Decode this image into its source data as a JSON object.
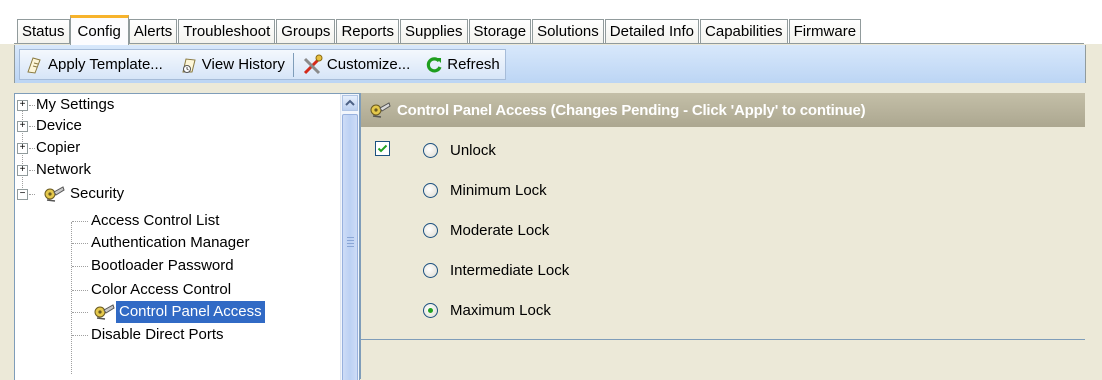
{
  "tabs": [
    "Status",
    "Config",
    "Alerts",
    "Troubleshoot",
    "Groups",
    "Reports",
    "Supplies",
    "Storage",
    "Solutions",
    "Detailed Info",
    "Capabilities",
    "Firmware"
  ],
  "active_tab": "Config",
  "toolbar": {
    "apply_template": "Apply Template...",
    "view_history": "View History",
    "customize": "Customize...",
    "refresh": "Refresh"
  },
  "tree": {
    "items": {
      "my_settings": "My Settings",
      "device": "Device",
      "copier": "Copier",
      "network": "Network",
      "security": "Security",
      "access_control_list": "Access Control List",
      "authentication_manager": "Authentication Manager",
      "bootloader_password": "Bootloader Password",
      "color_access_control": "Color Access Control",
      "control_panel_access": "Control Panel Access",
      "disable_direct_ports": "Disable Direct Ports"
    },
    "selected": "Control Panel Access"
  },
  "panel": {
    "title": "Control Panel Access (Changes Pending - Click 'Apply' to continue)",
    "enabled_checked": true,
    "options": [
      "Unlock",
      "Minimum Lock",
      "Moderate Lock",
      "Intermediate Lock",
      "Maximum Lock"
    ],
    "selected_option": "Maximum Lock"
  },
  "colors": {
    "selection": "#316ac5",
    "header": "#aca790",
    "toolbar": "#c8dcf6",
    "radio_dot": "#21a121"
  }
}
